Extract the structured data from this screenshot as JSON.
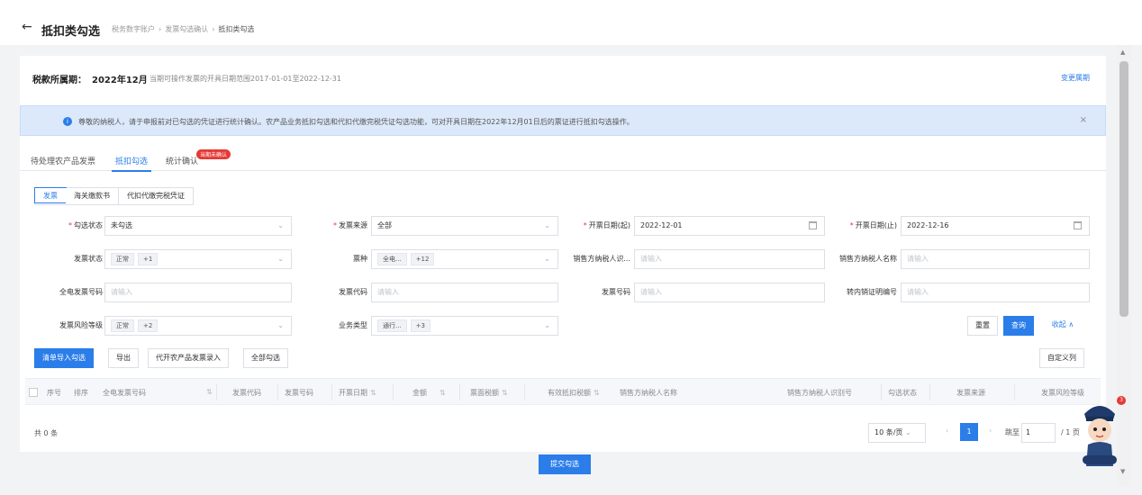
{
  "header": {
    "back_icon": "arrow-left-icon",
    "title": "抵扣类勾选",
    "breadcrumbs": [
      "税务数字账户",
      "发票勾选确认",
      "抵扣类勾选"
    ]
  },
  "period": {
    "label": "税款所属期：",
    "value": "2022年12月",
    "hint": "当期可操作发票的开具日期范围2017-01-01至2022-12-31",
    "change_link": "变更属期"
  },
  "notice": {
    "icon": "info-icon",
    "text": "尊敬的纳税人，请于申报前对已勾选的凭证进行统计确认。农产品业务抵扣勾选和代扣代缴完税凭证勾选功能，可对开具日期在2022年12月01日后的票证进行抵扣勾选操作。",
    "close": "×"
  },
  "tabs": [
    {
      "label": "待处理农产品发票"
    },
    {
      "label": "抵扣勾选"
    },
    {
      "label": "统计确认"
    }
  ],
  "tab_badge": "当期未确认",
  "subtabs": [
    "发票",
    "海关缴款书",
    "代扣代缴完税凭证"
  ],
  "filters": {
    "check_status": {
      "label": "勾选状态",
      "value": "未勾选"
    },
    "invoice_source": {
      "label": "发票来源",
      "value": "全部"
    },
    "date_start": {
      "label": "开票日期(起)",
      "value": "2022-12-01"
    },
    "date_end": {
      "label": "开票日期(止)",
      "value": "2022-12-16"
    },
    "invoice_status": {
      "label": "发票状态",
      "tag": "正常",
      "more": "+1"
    },
    "invoice_type": {
      "label": "票种",
      "tag": "全电...",
      "more": "+12"
    },
    "seller_tax_id": {
      "label": "销售方纳税人识...",
      "placeholder": "请输入"
    },
    "seller_name": {
      "label": "销售方纳税人名称",
      "placeholder": "请输入"
    },
    "all_e_invoice_no": {
      "label": "全电发票号码",
      "placeholder": "请输入"
    },
    "invoice_code": {
      "label": "发票代码",
      "placeholder": "请输入"
    },
    "invoice_no": {
      "label": "发票号码",
      "placeholder": "请输入"
    },
    "transfer_cert_no": {
      "label": "转内销证明编号",
      "placeholder": "请输入"
    },
    "risk_level": {
      "label": "发票风险等级",
      "tag": "正常",
      "more": "+2"
    },
    "biz_type": {
      "label": "业务类型",
      "tag": "通行...",
      "more": "+3"
    }
  },
  "filter_actions": {
    "reset": "重置",
    "query": "查询",
    "collapse": "收起 ∧"
  },
  "toolbar": {
    "import_check": "清单导入勾选",
    "export": "导出",
    "agri_entry": "代开农产品发票录入",
    "check_all": "全部勾选",
    "custom_columns": "自定义列"
  },
  "table": {
    "columns": [
      "序号",
      "排序",
      "全电发票号码",
      "发票代码",
      "发票号码",
      "开票日期",
      "金额",
      "票面税额",
      "有效抵扣税额",
      "销售方纳税人名称",
      "销售方纳税人识别号",
      "勾选状态",
      "发票来源",
      "发票风险等级"
    ]
  },
  "pagination": {
    "total": "共 0 条",
    "page_size": "10 条/页",
    "current_page": "1",
    "goto_label": "跳至",
    "goto_value": "1",
    "total_pages": "/ 1 页"
  },
  "submit": "提交勾选",
  "assistant": {
    "icon": "tax-assistant-avatar-icon",
    "badge": "3"
  },
  "colors": {
    "primary": "#2b7de9",
    "danger": "#e53935",
    "notice_bg": "#dce9fb"
  }
}
